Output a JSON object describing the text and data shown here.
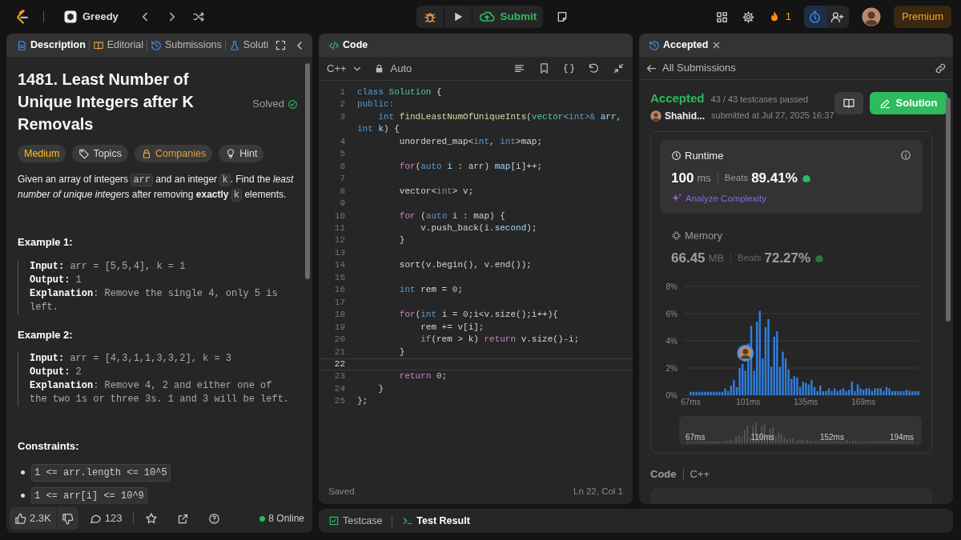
{
  "top_bar": {
    "problem_list": "Greedy",
    "submit": "Submit",
    "streak": "1",
    "premium": "Premium"
  },
  "description_panel": {
    "tabs": [
      {
        "label": "Description",
        "kind": "description",
        "selected": true
      },
      {
        "label": "Editorial",
        "kind": "editorial",
        "selected": false
      },
      {
        "label": "Submissions",
        "kind": "submissions",
        "selected": false
      },
      {
        "label": "Soluti",
        "kind": "solutions",
        "selected": false
      }
    ],
    "title": "1481. Least Number of Unique Integers after K Removals",
    "status": "Solved",
    "tags": [
      {
        "label": "Medium",
        "kind": "difficulty"
      },
      {
        "label": "Topics",
        "kind": "topics"
      },
      {
        "label": "Companies",
        "kind": "companies"
      },
      {
        "label": "Hint",
        "kind": "hint"
      }
    ],
    "statement": [
      {
        "kind": "text",
        "text": "Given an array of integers "
      },
      {
        "kind": "code",
        "text": "arr"
      },
      {
        "kind": "text",
        "text": " and an integer "
      },
      {
        "kind": "code",
        "text": "k"
      },
      {
        "kind": "text",
        "text": ". Find the *least number of unique integers* after removing **exactly** "
      },
      {
        "kind": "code",
        "text": "k"
      },
      {
        "kind": "text",
        "text": " elements."
      }
    ],
    "examples": [
      {
        "title": "Example 1:",
        "lines": [
          "**Input:** arr = [5,5,4], k = 1",
          "**Output:** 1",
          "**Explanation**: Remove the single 4, only 5 is left."
        ]
      },
      {
        "title": "Example 2:",
        "lines": [
          "**Input:** arr = [4,3,1,1,3,3,2], k = 3",
          "**Output:** 2",
          "**Explanation**: Remove 4, 2 and either one of the two 1s or three 3s. 1 and 3 will be left."
        ]
      }
    ],
    "constraints_title": "Constraints:",
    "constraints": [
      "1 <= arr.length <= 10^5",
      "1 <= arr[i] <= 10^9"
    ],
    "footer": {
      "likes": "2.3K",
      "comments": "123",
      "online": "8 Online"
    }
  },
  "code_panel": {
    "title": "Code",
    "language": "C++",
    "mode": "Auto",
    "status": "Saved",
    "cursor": "Ln 22, Col 1",
    "lines": [
      {
        "number": "1",
        "active": false,
        "tokens": [
          {
            "kind": "keyword",
            "text": "class "
          },
          {
            "kind": "type",
            "text": "Solution"
          },
          {
            "kind": "plain",
            "text": " {"
          }
        ]
      },
      {
        "number": "2",
        "active": false,
        "tokens": [
          {
            "kind": "keyword",
            "text": "public:"
          }
        ]
      },
      {
        "number": "3",
        "active": false,
        "tokens": [
          {
            "kind": "keyword",
            "text": "    int "
          },
          {
            "kind": "func",
            "text": "findLeastNumOfUniqueInts"
          },
          {
            "kind": "plain",
            "text": "("
          },
          {
            "kind": "type",
            "text": "vector<"
          },
          {
            "kind": "keyword",
            "text": "int"
          },
          {
            "kind": "keyword",
            "text": ">& "
          },
          {
            "kind": "var",
            "text": "arr"
          },
          {
            "kind": "plain",
            "text": ","
          }
        ],
        "wrapped": [
          {
            "kind": "keyword",
            "text": "int "
          },
          {
            "kind": "var",
            "text": "k"
          },
          {
            "kind": "plain",
            "text": ") {"
          }
        ]
      },
      {
        "number": "4",
        "active": false,
        "tokens": [
          {
            "kind": "plain",
            "text": "        unordered_map<"
          },
          {
            "kind": "keyword",
            "text": "int"
          },
          {
            "kind": "plain",
            "text": ", "
          },
          {
            "kind": "keyword",
            "text": "int"
          },
          {
            "kind": "plain",
            "text": ">map;"
          }
        ]
      },
      {
        "number": "5",
        "active": false
      },
      {
        "number": "6",
        "active": false,
        "tokens": [
          {
            "kind": "control",
            "text": "        for"
          },
          {
            "kind": "plain",
            "text": "("
          },
          {
            "kind": "keyword",
            "text": "auto "
          },
          {
            "kind": "var",
            "text": "i"
          },
          {
            "kind": "plain",
            "text": " : arr) "
          },
          {
            "kind": "var",
            "text": "map"
          },
          {
            "kind": "plain",
            "text": "[i]++;"
          }
        ]
      },
      {
        "number": "7",
        "active": false
      },
      {
        "number": "8",
        "active": false,
        "tokens": [
          {
            "kind": "plain",
            "text": "        vector<"
          },
          {
            "kind": "keyword",
            "text": "int"
          },
          {
            "kind": "plain",
            "text": "> v;"
          }
        ]
      },
      {
        "number": "9",
        "active": false
      },
      {
        "number": "10",
        "active": false,
        "tokens": [
          {
            "kind": "control",
            "text": "        for "
          },
          {
            "kind": "plain",
            "text": "("
          },
          {
            "kind": "keyword",
            "text": "auto "
          },
          {
            "kind": "var",
            "text": "i"
          },
          {
            "kind": "plain",
            "text": " : map) {"
          }
        ]
      },
      {
        "number": "11",
        "active": false,
        "tokens": [
          {
            "kind": "var",
            "text": "            v"
          },
          {
            "kind": "plain",
            "text": ".push_back("
          },
          {
            "kind": "var",
            "text": "i"
          },
          {
            "kind": "plain",
            "text": "."
          },
          {
            "kind": "var",
            "text": "second"
          },
          {
            "kind": "plain",
            "text": ");"
          }
        ]
      },
      {
        "number": "12",
        "active": false,
        "tokens": [
          {
            "kind": "plain",
            "text": "        }"
          }
        ]
      },
      {
        "number": "13",
        "active": false
      },
      {
        "number": "14",
        "active": false,
        "tokens": [
          {
            "kind": "plain",
            "text": "        sort("
          },
          {
            "kind": "var",
            "text": "v"
          },
          {
            "kind": "plain",
            "text": ".begin(), "
          },
          {
            "kind": "var",
            "text": "v"
          },
          {
            "kind": "plain",
            "text": ".end());"
          }
        ]
      },
      {
        "number": "15",
        "active": false
      },
      {
        "number": "16",
        "active": false,
        "tokens": [
          {
            "kind": "keyword",
            "text": "        int "
          },
          {
            "kind": "plain",
            "text": "rem = "
          },
          {
            "kind": "number",
            "text": "0"
          },
          {
            "kind": "plain",
            "text": ";"
          }
        ]
      },
      {
        "number": "17",
        "active": false
      },
      {
        "number": "18",
        "active": false,
        "tokens": [
          {
            "kind": "control",
            "text": "        for"
          },
          {
            "kind": "plain",
            "text": "("
          },
          {
            "kind": "keyword",
            "text": "int "
          },
          {
            "kind": "plain",
            "text": "i = "
          },
          {
            "kind": "number",
            "text": "0"
          },
          {
            "kind": "plain",
            "text": ";i<v.size();i++){"
          }
        ]
      },
      {
        "number": "19",
        "active": false,
        "tokens": [
          {
            "kind": "plain",
            "text": "            rem += "
          },
          {
            "kind": "var",
            "text": "v"
          },
          {
            "kind": "plain",
            "text": "[i];"
          }
        ]
      },
      {
        "number": "20",
        "active": false,
        "tokens": [
          {
            "kind": "control",
            "text": "            if"
          },
          {
            "kind": "plain",
            "text": "(rem > k) "
          },
          {
            "kind": "control",
            "text": "return "
          },
          {
            "kind": "plain",
            "text": "v.size()-i;"
          }
        ]
      },
      {
        "number": "21",
        "active": false,
        "tokens": [
          {
            "kind": "plain",
            "text": "        }"
          }
        ]
      },
      {
        "number": "22",
        "active": true
      },
      {
        "number": "23",
        "active": false,
        "tokens": [
          {
            "kind": "control",
            "text": "        return "
          },
          {
            "kind": "number",
            "text": "0"
          },
          {
            "kind": "plain",
            "text": ";"
          }
        ]
      },
      {
        "number": "24",
        "active": false,
        "tokens": [
          {
            "kind": "plain",
            "text": "    }"
          }
        ]
      },
      {
        "number": "25",
        "active": false,
        "tokens": [
          {
            "kind": "plain",
            "text": "};"
          }
        ]
      }
    ]
  },
  "submission_panel": {
    "tab": "Accepted",
    "back": "All Submissions",
    "result": "Accepted",
    "testcases": "43 / 43 testcases passed",
    "user": "Shahid...",
    "submitted": "submitted at Jul 27, 2025 16:37",
    "solution_button": "Solution",
    "metrics": [
      {
        "kind": "runtime",
        "label": "Runtime",
        "value": "100",
        "unit": "ms",
        "beats_label": "Beats",
        "beats": "89.41%",
        "link": "Analyze Complexity",
        "selected": true
      },
      {
        "kind": "memory",
        "label": "Memory",
        "value": "66.45",
        "unit": "MB",
        "beats_label": "Beats",
        "beats": "72.27%",
        "selected": false
      }
    ],
    "chart_data": {
      "type": "bar",
      "grid": true,
      "xlim": [
        63,
        202
      ],
      "ylim": [
        0,
        8
      ],
      "xticks": [
        {
          "value": 67,
          "label": "67ms"
        },
        {
          "value": 101,
          "label": "101ms"
        },
        {
          "value": 135,
          "label": "135ms"
        },
        {
          "value": 169,
          "label": "169ms"
        }
      ],
      "yticks": [
        {
          "value": 0,
          "label": "0%"
        },
        {
          "value": 2,
          "label": "2%"
        },
        {
          "value": 4,
          "label": "4%"
        },
        {
          "value": 6,
          "label": "6%"
        },
        {
          "value": 8,
          "label": "8%"
        }
      ],
      "x": [
        67,
        68.7,
        70.4,
        72.1,
        73.8,
        75.5,
        77.2,
        78.9,
        80.6,
        82.3,
        84,
        85.7,
        87.4,
        89.1,
        90.8,
        92.5,
        94.2,
        95.9,
        97.6,
        99.3,
        101,
        102.7,
        104.4,
        106.1,
        107.8,
        109.5,
        111.2,
        112.9,
        114.6,
        116.3,
        118,
        119.7,
        121.4,
        123.1,
        124.8,
        126.5,
        128.2,
        129.9,
        131.6,
        133.3,
        135,
        136.7,
        138.4,
        140.1,
        141.8,
        143.5,
        145.2,
        146.9,
        148.6,
        150.3,
        152,
        153.7,
        155.4,
        157.1,
        158.8,
        160.5,
        162.2,
        163.9,
        165.6,
        167.3,
        169,
        170.7,
        172.4,
        174.1,
        175.8,
        177.5,
        179.2,
        180.9,
        182.6,
        184.3,
        186,
        187.7,
        189.4,
        191.1,
        192.8,
        194.5,
        196.2,
        197.9,
        199.6,
        201.3
      ],
      "series": [
        {
          "color": "#2f7fe0",
          "values": [
            0.25,
            0.25,
            0.25,
            0.25,
            0.25,
            0.25,
            0.25,
            0.25,
            0.25,
            0.25,
            0.25,
            0.25,
            0.5,
            0.3,
            0.7,
            1.1,
            0.6,
            2.0,
            2.3,
            1.8,
            3.8,
            5.1,
            1.8,
            5.4,
            6.2,
            2.7,
            5.0,
            5.6,
            2.1,
            4.3,
            4.7,
            2.1,
            3.2,
            2.7,
            1.9,
            1.2,
            1.4,
            1.3,
            0.6,
            1.0,
            0.9,
            0.8,
            1.1,
            0.6,
            0.3,
            0.7,
            0.3,
            0.3,
            0.5,
            0.3,
            0.5,
            0.3,
            0.4,
            0.5,
            0.3,
            0.4,
            1.0,
            0.3,
            0.8,
            0.5,
            0.4,
            0.5,
            0.5,
            0.3,
            0.5,
            0.5,
            0.5,
            0.3,
            0.6,
            0.5,
            0.3,
            0.3,
            0.3,
            0.3,
            0.3,
            0.4,
            0.3,
            0.3,
            0.3,
            0.3
          ]
        }
      ]
    },
    "overview_labels": [
      "67ms",
      "110ms",
      "152ms",
      "194ms"
    ],
    "code_heading": "Code",
    "code_language": "C++"
  },
  "bottom_panel": {
    "tabs": [
      {
        "label": "Testcase",
        "kind": "testcase",
        "selected": false
      },
      {
        "label": "Test Result",
        "kind": "result",
        "selected": true
      }
    ]
  }
}
